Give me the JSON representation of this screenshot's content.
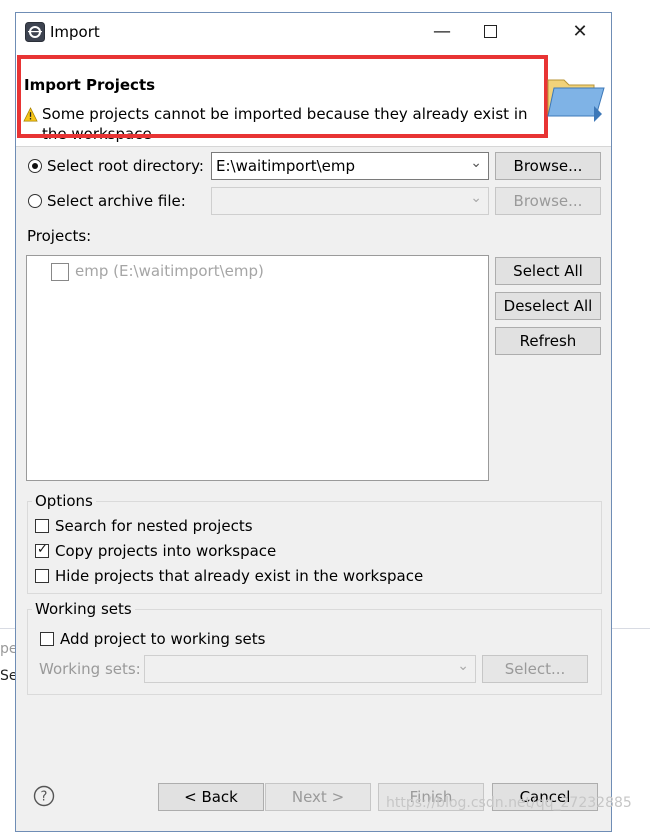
{
  "window": {
    "title": "Import"
  },
  "header": {
    "title": "Import Projects",
    "message": "Some projects cannot be imported because they already exist in the workspace"
  },
  "source": {
    "root_label": "Select root directory:",
    "root_value": "E:\\waitimport\\emp",
    "archive_label": "Select archive file:",
    "archive_value": "",
    "browse_label": "Browse...",
    "root_selected": true
  },
  "projects": {
    "label": "Projects:",
    "items": [
      {
        "label": "emp (E:\\waitimport\\emp)",
        "checked": false,
        "enabled": false
      }
    ],
    "select_all": "Select All",
    "deselect_all": "Deselect All",
    "refresh": "Refresh"
  },
  "options": {
    "label": "Options",
    "nested": "Search for nested projects",
    "nested_checked": false,
    "copy": "Copy projects into workspace",
    "copy_checked": true,
    "hide": "Hide projects that already exist in the workspace",
    "hide_checked": false
  },
  "working_sets": {
    "label": "Working sets",
    "add": "Add project to working sets",
    "add_checked": false,
    "sets_label": "Working sets:",
    "sets_value": "",
    "select_button": "Select..."
  },
  "footer": {
    "help_icon": "help-icon",
    "back": "< Back",
    "next": "Next >",
    "finish": "Finish",
    "cancel": "Cancel"
  },
  "background": {
    "text_1": "pe",
    "text_2": "Se"
  },
  "watermark": "https://blog.csdn.net/qq_27232885",
  "colors": {
    "highlight": "#e83434",
    "window_border": "#6f8db5",
    "dialog_bg": "#f0f0f0"
  }
}
